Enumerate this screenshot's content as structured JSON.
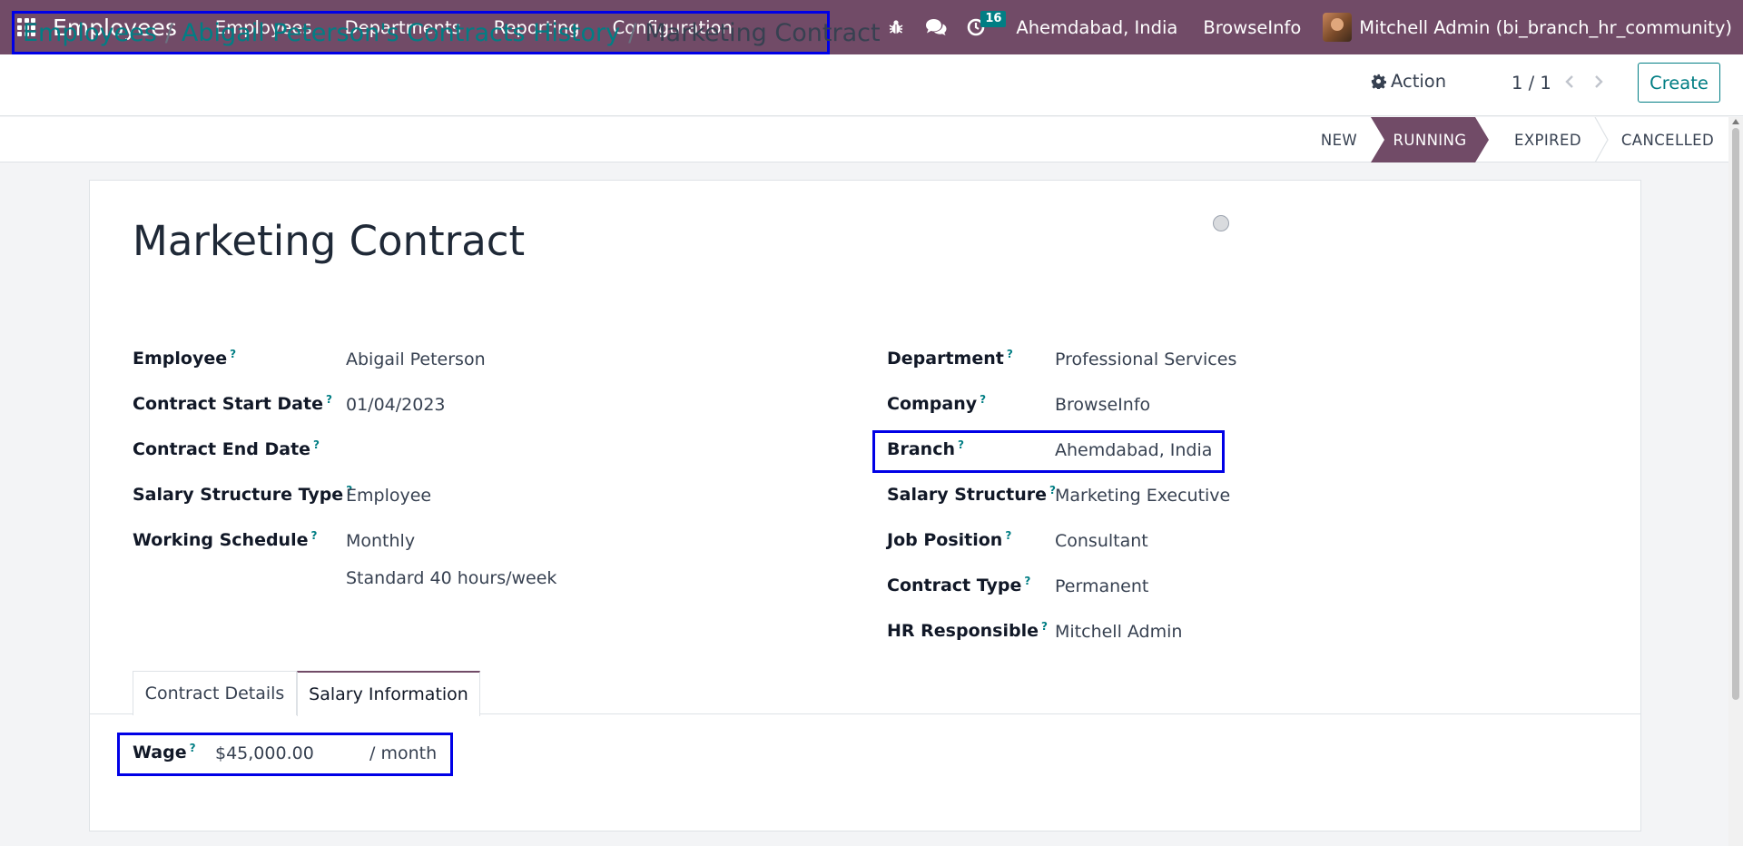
{
  "navbar": {
    "brand": "Employees",
    "menu": [
      "Employees",
      "Departments",
      "Reporting",
      "Configuration"
    ],
    "activity_count": "16",
    "branch": "Ahemdabad, India",
    "company": "BrowseInfo",
    "user": "Mitchell Admin (bi_branch_hr_community)",
    "icons": [
      "apps-grid-icon",
      "bug-icon",
      "chat-icon",
      "clock-icon"
    ],
    "color": "#714b67"
  },
  "breadcrumb": {
    "items": [
      "Employees",
      "Abigail Peterson's Contracts History"
    ],
    "current": "Marketing Contract",
    "separator": "/"
  },
  "toolbar": {
    "action_label": "Action",
    "pager": "1 / 1",
    "create_label": "Create"
  },
  "status": {
    "stages": [
      "NEW",
      "RUNNING",
      "EXPIRED",
      "CANCELLED"
    ],
    "active": "RUNNING"
  },
  "form": {
    "title": "Marketing Contract",
    "help_marker": "?",
    "left": [
      {
        "label": "Employee",
        "value": "Abigail Peterson"
      },
      {
        "label": "Contract Start Date",
        "value": "01/04/2023"
      },
      {
        "label": "Contract End Date",
        "value": ""
      },
      {
        "label": "Salary Structure Type",
        "value": "Employee"
      },
      {
        "label": "Working Schedule",
        "value": "Monthly",
        "value2": "Standard 40 hours/week"
      }
    ],
    "right": [
      {
        "label": "Department",
        "value": "Professional Services"
      },
      {
        "label": "Company",
        "value": "BrowseInfo"
      },
      {
        "label": "Branch",
        "value": "Ahemdabad, India"
      },
      {
        "label": "Salary Structure",
        "value": "Marketing Executive"
      },
      {
        "label": "Job Position",
        "value": "Consultant"
      },
      {
        "label": "Contract Type",
        "value": "Permanent"
      },
      {
        "label": "HR Responsible",
        "value": "Mitchell Admin"
      }
    ]
  },
  "tabs": {
    "items": [
      "Contract Details",
      "Salary Information"
    ],
    "active": "Salary Information"
  },
  "wage": {
    "label": "Wage",
    "value": "$45,000.00",
    "unit": "/ month"
  },
  "colors": {
    "accent": "#714b67",
    "link": "#017e84",
    "highlight_box": "#0000e6"
  }
}
